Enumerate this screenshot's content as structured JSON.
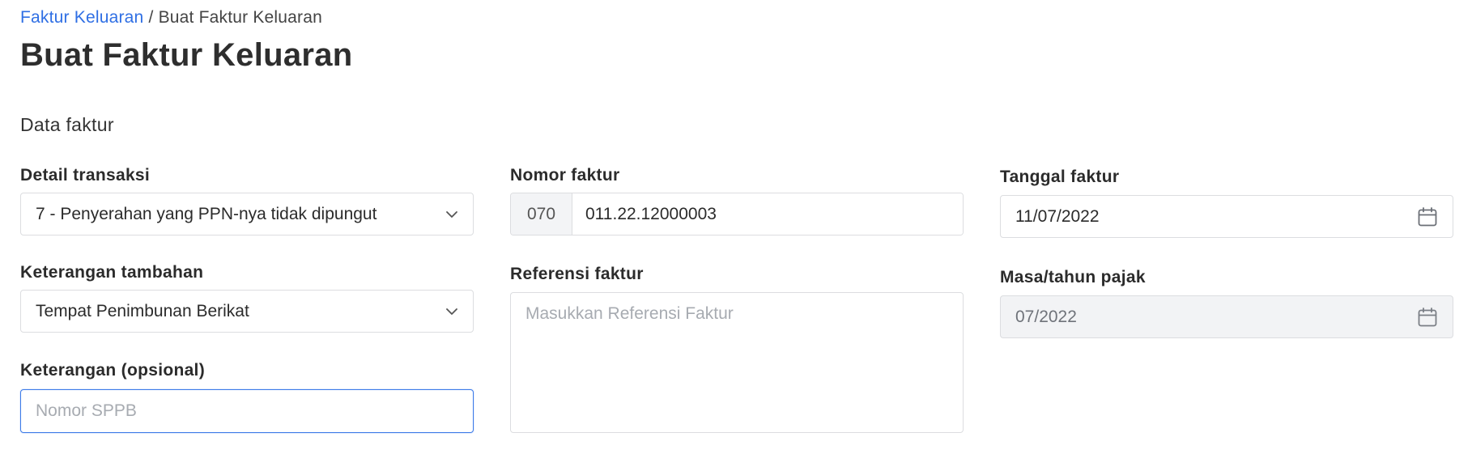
{
  "breadcrumb": {
    "parent": "Faktur Keluaran",
    "separator": "/",
    "current": "Buat Faktur Keluaran"
  },
  "page_title": "Buat Faktur Keluaran",
  "section_title": "Data faktur",
  "fields": {
    "detail_transaksi": {
      "label": "Detail transaksi",
      "value": "7 - Penyerahan yang PPN-nya tidak dipungut"
    },
    "keterangan_tambahan": {
      "label": "Keterangan tambahan",
      "value": "Tempat Penimbunan Berikat"
    },
    "keterangan_opsional": {
      "label": "Keterangan (opsional)",
      "placeholder": "Nomor SPPB",
      "value": ""
    },
    "nomor_faktur": {
      "label": "Nomor faktur",
      "prefix": "070",
      "value": "011.22.12000003"
    },
    "referensi_faktur": {
      "label": "Referensi faktur",
      "placeholder": "Masukkan Referensi Faktur",
      "value": ""
    },
    "tanggal_faktur": {
      "label": "Tanggal faktur",
      "value": "11/07/2022"
    },
    "masa_tahun_pajak": {
      "label": "Masa/tahun pajak",
      "value": "07/2022"
    }
  },
  "icons": {
    "select_chevron": "chevron-down-icon",
    "date_picker": "calendar-icon"
  },
  "colors": {
    "link": "#2f6fe4",
    "focus_border": "#3d7be8",
    "disabled_bg": "#f2f3f5"
  }
}
